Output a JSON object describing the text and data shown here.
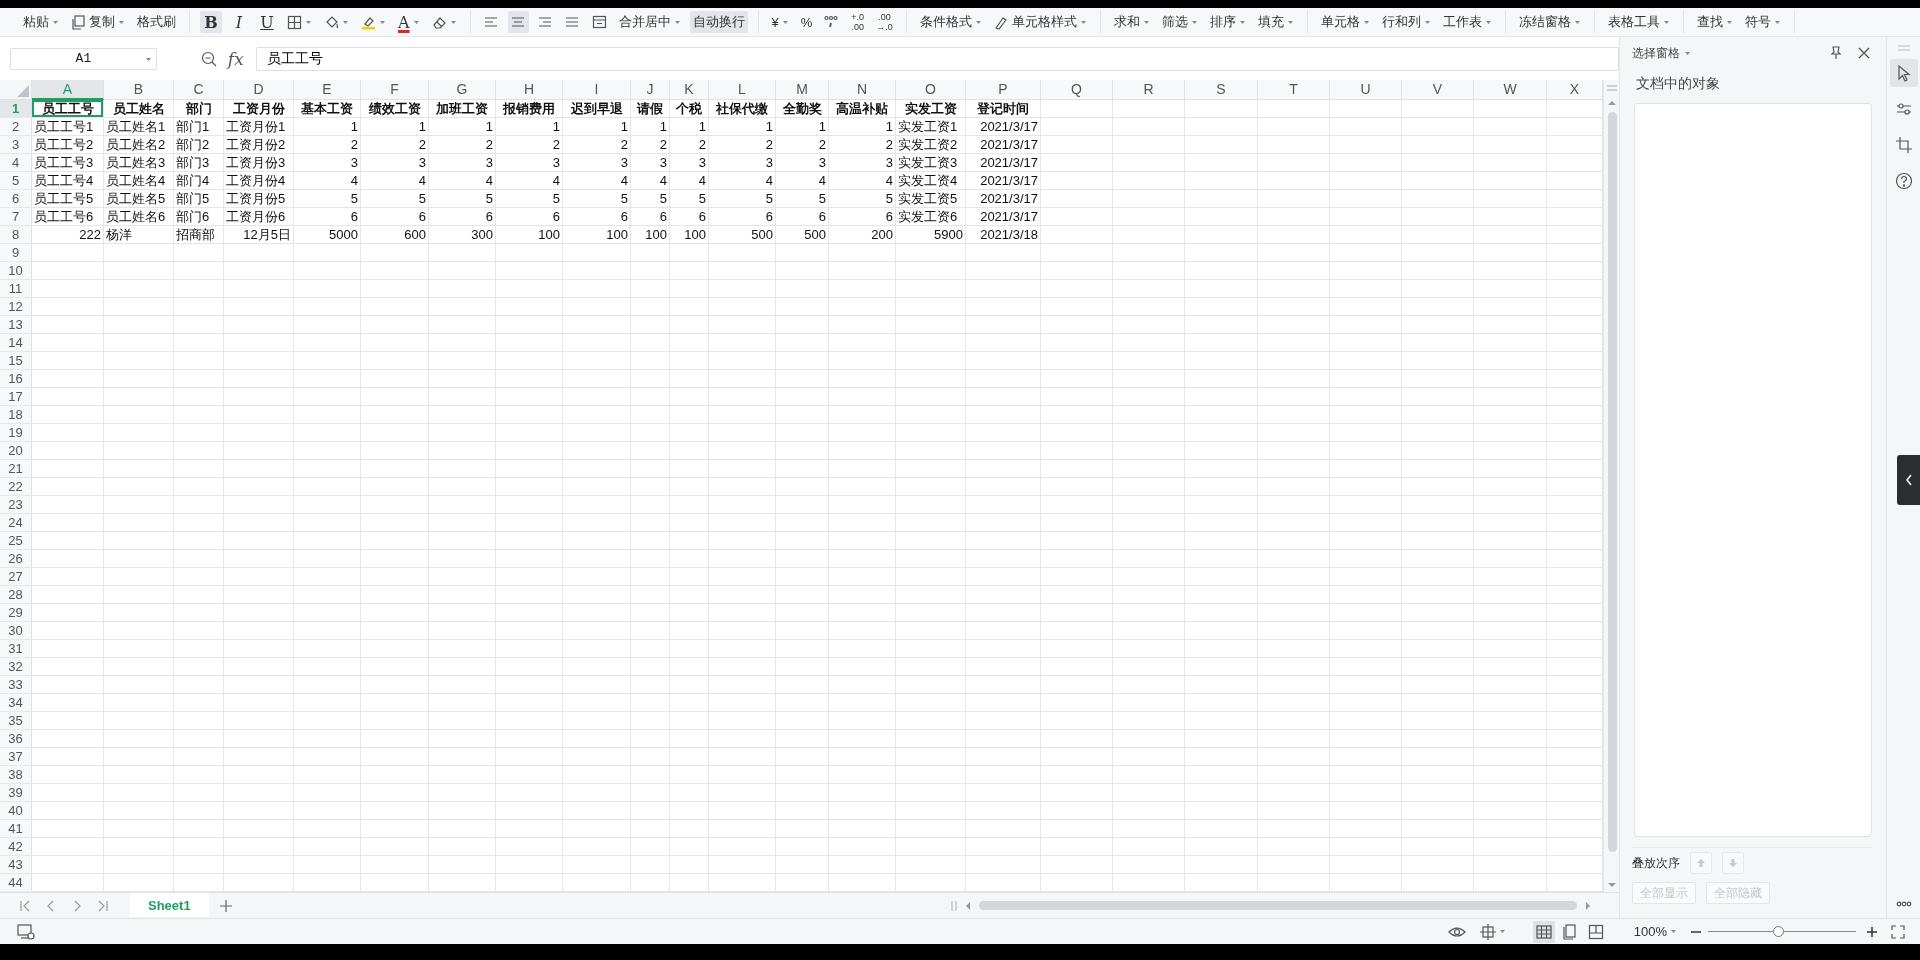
{
  "toolbar": [
    {
      "items": [
        {
          "kind": "text",
          "label": "粘贴",
          "dropdown": true,
          "on": false
        },
        {
          "kind": "copy",
          "label": "复制",
          "dropdown": true,
          "on": false
        },
        {
          "kind": "text",
          "label": "格式刷",
          "dropdown": false,
          "on": false
        }
      ]
    },
    {
      "items": [
        {
          "kind": "bold",
          "label": "B",
          "dropdown": false,
          "on": true
        },
        {
          "kind": "italic",
          "label": "I",
          "dropdown": false,
          "on": false
        },
        {
          "kind": "underline",
          "label": "U",
          "dropdown": false,
          "on": false
        },
        {
          "kind": "border",
          "dropdown": true,
          "on": false
        },
        {
          "kind": "fill",
          "dropdown": true,
          "on": false
        },
        {
          "kind": "highlight",
          "dropdown": true,
          "on": false
        },
        {
          "kind": "fontcolor",
          "label": "A",
          "dropdown": true,
          "on": false
        },
        {
          "kind": "eraser",
          "dropdown": true,
          "on": false
        }
      ]
    },
    {
      "items": [
        {
          "kind": "alignleft",
          "dropdown": false,
          "on": false
        },
        {
          "kind": "aligncenter",
          "dropdown": false,
          "on": true
        },
        {
          "kind": "alignright",
          "dropdown": false,
          "on": false
        },
        {
          "kind": "justify",
          "dropdown": false,
          "on": false
        },
        {
          "kind": "merge",
          "dropdown": false,
          "on": false
        },
        {
          "kind": "text",
          "label": "合并居中",
          "dropdown": true,
          "on": false
        },
        {
          "kind": "text",
          "label": "自动换行",
          "dropdown": false,
          "on": true
        }
      ]
    },
    {
      "items": [
        {
          "kind": "text",
          "label": "¥",
          "dropdown": true,
          "on": false
        },
        {
          "kind": "text",
          "label": "%",
          "dropdown": false,
          "on": false
        },
        {
          "kind": "thousands",
          "dropdown": false,
          "on": false
        },
        {
          "kind": "stack",
          "lines": [
            "+.0",
            ".00"
          ],
          "dropdown": false,
          "on": false
        },
        {
          "kind": "stack",
          "lines": [
            ".00",
            "→.0"
          ],
          "dropdown": false,
          "on": false
        }
      ]
    },
    {
      "items": [
        {
          "kind": "text",
          "label": "条件格式",
          "dropdown": true,
          "on": false
        },
        {
          "kind": "cellstyle",
          "label": "单元格样式",
          "dropdown": true,
          "on": false
        }
      ]
    },
    {
      "items": [
        {
          "kind": "text",
          "label": "求和",
          "dropdown": true,
          "on": false
        },
        {
          "kind": "text",
          "label": "筛选",
          "dropdown": true,
          "on": false
        },
        {
          "kind": "text",
          "label": "排序",
          "dropdown": true,
          "on": false
        },
        {
          "kind": "text",
          "label": "填充",
          "dropdown": true,
          "on": false
        }
      ]
    },
    {
      "items": [
        {
          "kind": "text",
          "label": "单元格",
          "dropdown": true,
          "on": false
        },
        {
          "kind": "text",
          "label": "行和列",
          "dropdown": true,
          "on": false
        },
        {
          "kind": "text",
          "label": "工作表",
          "dropdown": true,
          "on": false
        }
      ]
    },
    {
      "items": [
        {
          "kind": "text",
          "label": "冻结窗格",
          "dropdown": true,
          "on": false
        }
      ]
    },
    {
      "items": [
        {
          "kind": "text",
          "label": "表格工具",
          "dropdown": true,
          "on": false
        }
      ]
    },
    {
      "items": [
        {
          "kind": "text",
          "label": "查找",
          "dropdown": true,
          "on": false
        },
        {
          "kind": "text",
          "label": "符号",
          "dropdown": true,
          "on": false
        }
      ]
    }
  ],
  "formula_bar": {
    "cell_name": "A1",
    "function_label": "fx",
    "value": "员工工号"
  },
  "columns": [
    {
      "label": "A",
      "selected": true
    },
    {
      "label": "B",
      "selected": false
    },
    {
      "label": "C",
      "selected": false
    },
    {
      "label": "D",
      "selected": false
    },
    {
      "label": "E",
      "selected": false
    },
    {
      "label": "F",
      "selected": false
    },
    {
      "label": "G",
      "selected": false
    },
    {
      "label": "H",
      "selected": false
    },
    {
      "label": "I",
      "selected": false
    },
    {
      "label": "J",
      "selected": false
    },
    {
      "label": "K",
      "selected": false
    },
    {
      "label": "L",
      "selected": false
    },
    {
      "label": "M",
      "selected": false
    },
    {
      "label": "N",
      "selected": false
    },
    {
      "label": "O",
      "selected": false
    },
    {
      "label": "P",
      "selected": false
    },
    {
      "label": "Q",
      "selected": false
    },
    {
      "label": "R",
      "selected": false
    },
    {
      "label": "S",
      "selected": false
    },
    {
      "label": "T",
      "selected": false
    },
    {
      "label": "U",
      "selected": false
    },
    {
      "label": "V",
      "selected": false
    },
    {
      "label": "W",
      "selected": false
    },
    {
      "label": "X",
      "selected": false
    }
  ],
  "rows": [
    {
      "number": "1",
      "selected": true,
      "bold": true,
      "cells": [
        {
          "text": "员工工号",
          "kind": "heading",
          "selected": true
        },
        {
          "text": "员工姓名",
          "kind": "heading",
          "selected": false
        },
        {
          "text": "部门",
          "kind": "heading",
          "selected": false
        },
        {
          "text": "工资月份",
          "kind": "heading",
          "selected": false
        },
        {
          "text": "基本工资",
          "kind": "heading",
          "selected": false
        },
        {
          "text": "绩效工资",
          "kind": "heading",
          "selected": false
        },
        {
          "text": "加班工资",
          "kind": "heading",
          "selected": false
        },
        {
          "text": "报销费用",
          "kind": "heading",
          "selected": false
        },
        {
          "text": "迟到早退",
          "kind": "heading",
          "selected": false
        },
        {
          "text": "请假",
          "kind": "heading",
          "selected": false
        },
        {
          "text": "个税",
          "kind": "heading",
          "selected": false
        },
        {
          "text": "社保代缴",
          "kind": "heading",
          "selected": false
        },
        {
          "text": "全勤奖",
          "kind": "heading",
          "selected": false
        },
        {
          "text": "高温补贴",
          "kind": "heading",
          "selected": false
        },
        {
          "text": "实发工资",
          "kind": "heading",
          "selected": false
        },
        {
          "text": "登记时间",
          "kind": "heading",
          "selected": false
        }
      ]
    },
    {
      "number": "2",
      "selected": false,
      "bold": false,
      "cells": [
        {
          "text": "员工工号1",
          "kind": "text",
          "selected": false
        },
        {
          "text": "员工姓名1",
          "kind": "text",
          "selected": false
        },
        {
          "text": "部门1",
          "kind": "text",
          "selected": false
        },
        {
          "text": "工资月份1",
          "kind": "text",
          "selected": false
        },
        {
          "text": "1",
          "kind": "number",
          "selected": false
        },
        {
          "text": "1",
          "kind": "number",
          "selected": false
        },
        {
          "text": "1",
          "kind": "number",
          "selected": false
        },
        {
          "text": "1",
          "kind": "number",
          "selected": false
        },
        {
          "text": "1",
          "kind": "number",
          "selected": false
        },
        {
          "text": "1",
          "kind": "number",
          "selected": false
        },
        {
          "text": "1",
          "kind": "number",
          "selected": false
        },
        {
          "text": "1",
          "kind": "number",
          "selected": false
        },
        {
          "text": "1",
          "kind": "number",
          "selected": false
        },
        {
          "text": "1",
          "kind": "number",
          "selected": false
        },
        {
          "text": "实发工资1",
          "kind": "text",
          "selected": false
        },
        {
          "text": "2021/3/17",
          "kind": "number",
          "selected": false
        }
      ]
    },
    {
      "number": "3",
      "selected": false,
      "bold": false,
      "cells": [
        {
          "text": "员工工号2",
          "kind": "text",
          "selected": false
        },
        {
          "text": "员工姓名2",
          "kind": "text",
          "selected": false
        },
        {
          "text": "部门2",
          "kind": "text",
          "selected": false
        },
        {
          "text": "工资月份2",
          "kind": "text",
          "selected": false
        },
        {
          "text": "2",
          "kind": "number",
          "selected": false
        },
        {
          "text": "2",
          "kind": "number",
          "selected": false
        },
        {
          "text": "2",
          "kind": "number",
          "selected": false
        },
        {
          "text": "2",
          "kind": "number",
          "selected": false
        },
        {
          "text": "2",
          "kind": "number",
          "selected": false
        },
        {
          "text": "2",
          "kind": "number",
          "selected": false
        },
        {
          "text": "2",
          "kind": "number",
          "selected": false
        },
        {
          "text": "2",
          "kind": "number",
          "selected": false
        },
        {
          "text": "2",
          "kind": "number",
          "selected": false
        },
        {
          "text": "2",
          "kind": "number",
          "selected": false
        },
        {
          "text": "实发工资2",
          "kind": "text",
          "selected": false
        },
        {
          "text": "2021/3/17",
          "kind": "number",
          "selected": false
        }
      ]
    },
    {
      "number": "4",
      "selected": false,
      "bold": false,
      "cells": [
        {
          "text": "员工工号3",
          "kind": "text",
          "selected": false
        },
        {
          "text": "员工姓名3",
          "kind": "text",
          "selected": false
        },
        {
          "text": "部门3",
          "kind": "text",
          "selected": false
        },
        {
          "text": "工资月份3",
          "kind": "text",
          "selected": false
        },
        {
          "text": "3",
          "kind": "number",
          "selected": false
        },
        {
          "text": "3",
          "kind": "number",
          "selected": false
        },
        {
          "text": "3",
          "kind": "number",
          "selected": false
        },
        {
          "text": "3",
          "kind": "number",
          "selected": false
        },
        {
          "text": "3",
          "kind": "number",
          "selected": false
        },
        {
          "text": "3",
          "kind": "number",
          "selected": false
        },
        {
          "text": "3",
          "kind": "number",
          "selected": false
        },
        {
          "text": "3",
          "kind": "number",
          "selected": false
        },
        {
          "text": "3",
          "kind": "number",
          "selected": false
        },
        {
          "text": "3",
          "kind": "number",
          "selected": false
        },
        {
          "text": "实发工资3",
          "kind": "text",
          "selected": false
        },
        {
          "text": "2021/3/17",
          "kind": "number",
          "selected": false
        }
      ]
    },
    {
      "number": "5",
      "selected": false,
      "bold": false,
      "cells": [
        {
          "text": "员工工号4",
          "kind": "text",
          "selected": false
        },
        {
          "text": "员工姓名4",
          "kind": "text",
          "selected": false
        },
        {
          "text": "部门4",
          "kind": "text",
          "selected": false
        },
        {
          "text": "工资月份4",
          "kind": "text",
          "selected": false
        },
        {
          "text": "4",
          "kind": "number",
          "selected": false
        },
        {
          "text": "4",
          "kind": "number",
          "selected": false
        },
        {
          "text": "4",
          "kind": "number",
          "selected": false
        },
        {
          "text": "4",
          "kind": "number",
          "selected": false
        },
        {
          "text": "4",
          "kind": "number",
          "selected": false
        },
        {
          "text": "4",
          "kind": "number",
          "selected": false
        },
        {
          "text": "4",
          "kind": "number",
          "selected": false
        },
        {
          "text": "4",
          "kind": "number",
          "selected": false
        },
        {
          "text": "4",
          "kind": "number",
          "selected": false
        },
        {
          "text": "4",
          "kind": "number",
          "selected": false
        },
        {
          "text": "实发工资4",
          "kind": "text",
          "selected": false
        },
        {
          "text": "2021/3/17",
          "kind": "number",
          "selected": false
        }
      ]
    },
    {
      "number": "6",
      "selected": false,
      "bold": false,
      "cells": [
        {
          "text": "员工工号5",
          "kind": "text",
          "selected": false
        },
        {
          "text": "员工姓名5",
          "kind": "text",
          "selected": false
        },
        {
          "text": "部门5",
          "kind": "text",
          "selected": false
        },
        {
          "text": "工资月份5",
          "kind": "text",
          "selected": false
        },
        {
          "text": "5",
          "kind": "number",
          "selected": false
        },
        {
          "text": "5",
          "kind": "number",
          "selected": false
        },
        {
          "text": "5",
          "kind": "number",
          "selected": false
        },
        {
          "text": "5",
          "kind": "number",
          "selected": false
        },
        {
          "text": "5",
          "kind": "number",
          "selected": false
        },
        {
          "text": "5",
          "kind": "number",
          "selected": false
        },
        {
          "text": "5",
          "kind": "number",
          "selected": false
        },
        {
          "text": "5",
          "kind": "number",
          "selected": false
        },
        {
          "text": "5",
          "kind": "number",
          "selected": false
        },
        {
          "text": "5",
          "kind": "number",
          "selected": false
        },
        {
          "text": "实发工资5",
          "kind": "text",
          "selected": false
        },
        {
          "text": "2021/3/17",
          "kind": "number",
          "selected": false
        }
      ]
    },
    {
      "number": "7",
      "selected": false,
      "bold": false,
      "cells": [
        {
          "text": "员工工号6",
          "kind": "text",
          "selected": false
        },
        {
          "text": "员工姓名6",
          "kind": "text",
          "selected": false
        },
        {
          "text": "部门6",
          "kind": "text",
          "selected": false
        },
        {
          "text": "工资月份6",
          "kind": "text",
          "selected": false
        },
        {
          "text": "6",
          "kind": "number",
          "selected": false
        },
        {
          "text": "6",
          "kind": "number",
          "selected": false
        },
        {
          "text": "6",
          "kind": "number",
          "selected": false
        },
        {
          "text": "6",
          "kind": "number",
          "selected": false
        },
        {
          "text": "6",
          "kind": "number",
          "selected": false
        },
        {
          "text": "6",
          "kind": "number",
          "selected": false
        },
        {
          "text": "6",
          "kind": "number",
          "selected": false
        },
        {
          "text": "6",
          "kind": "number",
          "selected": false
        },
        {
          "text": "6",
          "kind": "number",
          "selected": false
        },
        {
          "text": "6",
          "kind": "number",
          "selected": false
        },
        {
          "text": "实发工资6",
          "kind": "text",
          "selected": false
        },
        {
          "text": "2021/3/17",
          "kind": "number",
          "selected": false
        }
      ]
    },
    {
      "number": "8",
      "selected": false,
      "bold": false,
      "cells": [
        {
          "text": "222",
          "kind": "number",
          "selected": false
        },
        {
          "text": "杨洋",
          "kind": "text",
          "selected": false
        },
        {
          "text": "招商部",
          "kind": "text",
          "selected": false
        },
        {
          "text": "12月5日",
          "kind": "number",
          "selected": false
        },
        {
          "text": "5000",
          "kind": "number",
          "selected": false
        },
        {
          "text": "600",
          "kind": "number",
          "selected": false
        },
        {
          "text": "300",
          "kind": "number",
          "selected": false
        },
        {
          "text": "100",
          "kind": "number",
          "selected": false
        },
        {
          "text": "100",
          "kind": "number",
          "selected": false
        },
        {
          "text": "100",
          "kind": "number",
          "selected": false
        },
        {
          "text": "100",
          "kind": "number",
          "selected": false
        },
        {
          "text": "500",
          "kind": "number",
          "selected": false
        },
        {
          "text": "500",
          "kind": "number",
          "selected": false
        },
        {
          "text": "200",
          "kind": "number",
          "selected": false
        },
        {
          "text": "5900",
          "kind": "number",
          "selected": false
        },
        {
          "text": "2021/3/18",
          "kind": "number",
          "selected": false
        }
      ]
    },
    {
      "number": "9",
      "selected": false
    },
    {
      "number": "10",
      "selected": false
    },
    {
      "number": "11",
      "selected": false
    },
    {
      "number": "12",
      "selected": false
    },
    {
      "number": "13",
      "selected": false
    },
    {
      "number": "14",
      "selected": false
    },
    {
      "number": "15",
      "selected": false
    },
    {
      "number": "16",
      "selected": false
    },
    {
      "number": "17",
      "selected": false
    },
    {
      "number": "18",
      "selected": false
    },
    {
      "number": "19",
      "selected": false
    },
    {
      "number": "20",
      "selected": false
    },
    {
      "number": "21",
      "selected": false
    },
    {
      "number": "22",
      "selected": false
    },
    {
      "number": "23",
      "selected": false
    },
    {
      "number": "24",
      "selected": false
    },
    {
      "number": "25",
      "selected": false
    },
    {
      "number": "26",
      "selected": false
    },
    {
      "number": "27",
      "selected": false
    },
    {
      "number": "28",
      "selected": false
    },
    {
      "number": "29",
      "selected": false
    },
    {
      "number": "30",
      "selected": false
    },
    {
      "number": "31",
      "selected": false
    },
    {
      "number": "32",
      "selected": false
    },
    {
      "number": "33",
      "selected": false
    },
    {
      "number": "34",
      "selected": false
    },
    {
      "number": "35",
      "selected": false
    },
    {
      "number": "36",
      "selected": false
    },
    {
      "number": "37",
      "selected": false
    },
    {
      "number": "38",
      "selected": false
    },
    {
      "number": "39",
      "selected": false
    },
    {
      "number": "40",
      "selected": false
    },
    {
      "number": "41",
      "selected": false
    },
    {
      "number": "42",
      "selected": false
    },
    {
      "number": "43",
      "selected": false
    },
    {
      "number": "44",
      "selected": false
    }
  ],
  "sheet_tabs": [
    {
      "label": "Sheet1",
      "selected": true
    }
  ],
  "selection_pane": {
    "title": "选择窗格",
    "objects_label": "文档中的对象",
    "order_label": "叠放次序",
    "buttons": [
      {
        "label": "全部显示",
        "disabled": true
      },
      {
        "label": "全部隐藏",
        "disabled": true
      }
    ]
  },
  "status_bar": {
    "zoom": "100%",
    "zoom_slider": {
      "level": 0.47
    },
    "views": [
      {
        "kind": "normal",
        "selected": true
      },
      {
        "kind": "page",
        "selected": false
      },
      {
        "kind": "preview",
        "selected": false
      }
    ]
  }
}
